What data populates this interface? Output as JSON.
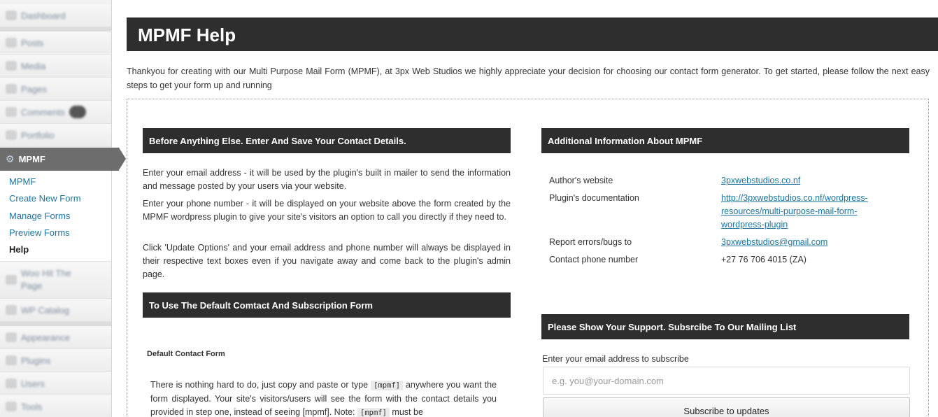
{
  "sidebar": {
    "items_top": [
      {
        "label": "Dashboard",
        "icon": "dashboard-icon"
      },
      {
        "label": "Posts",
        "icon": "posts-icon"
      },
      {
        "label": "Media",
        "icon": "media-icon"
      },
      {
        "label": "Pages",
        "icon": "pages-icon"
      },
      {
        "label": "Comments",
        "icon": "comments-icon"
      },
      {
        "label": "Portfolio",
        "icon": "portfolio-icon"
      }
    ],
    "current": {
      "label": "MPMF",
      "icon": "gear-icon"
    },
    "submenu": [
      {
        "label": "MPMF"
      },
      {
        "label": "Create New Form"
      },
      {
        "label": "Manage Forms"
      },
      {
        "label": "Preview Forms"
      },
      {
        "label": "Help",
        "active": true
      }
    ],
    "items_bottom": [
      {
        "label": "Woo Hit The Page",
        "icon": "plugin-icon"
      },
      {
        "label": "WP Catalog",
        "icon": "catalog-icon"
      },
      {
        "label": "Appearance",
        "icon": "appearance-icon"
      },
      {
        "label": "Plugins",
        "icon": "plugins-icon"
      },
      {
        "label": "Users",
        "icon": "users-icon"
      },
      {
        "label": "Tools",
        "icon": "tools-icon"
      }
    ]
  },
  "header": {
    "title": "MPMF Help"
  },
  "intro": "Thankyou for creating with our Multi Purpose Mail Form (MPMF), at 3px Web Studios we highly appreciate your decision for choosing our contact form generator. To get started, please follow the next easy steps to get your form up and running",
  "left": {
    "section1": {
      "title": "Before Anything Else. Enter And Save Your Contact Details.",
      "para1": "Enter your email address - it will be used by the plugin's built in mailer to send the information and message posted by your users via your website.",
      "para2": "Enter your phone number - it will be displayed on your website above the form created by the MPMF wordpress plugin to give your site's visitors an option to call you directly if they need to.",
      "para3": "Click 'Update Options' and your email address and phone number will always be displayed in their respective text boxes even if you navigate away and come back to the plugin's admin page."
    },
    "section2": {
      "title": "To Use The Default Comtact And Subscription Form",
      "form_title": "Default Contact Form",
      "text_a": "There is nothing hard to do, just copy and paste or type ",
      "code": "[mpmf]",
      "text_b": " anywhere you want the form displayed. Your site's visitors/users will see the form with the contact details you provided in step one, instead of seeing [mpmf]. Note: ",
      "text_c": " must be"
    }
  },
  "right": {
    "info": {
      "title": "Additional Information About MPMF",
      "rows": [
        {
          "label": "Author's website",
          "value": "3pxwebstudios.co.nf",
          "link": true
        },
        {
          "label": "Plugin's documentation",
          "value": "http://3pxwebstudios.co.nf/wordpress-resources/multi-purpose-mail-form-wordpress-plugin",
          "link": true
        },
        {
          "label": "Report errors/bugs to",
          "value": "3pxwebstudios@gmail.com",
          "link": true
        },
        {
          "label": "Contact phone number",
          "value": "+27 76 706 4015 (ZA)",
          "link": false
        }
      ]
    },
    "support": {
      "title": "Please Show Your Support. Subsrcibe To Our Mailing List",
      "label": "Enter your email address to subscribe",
      "placeholder": "e.g. you@your-domain.com",
      "button": "Subscribe  to updates"
    }
  },
  "colors": {
    "header_bg": "#2e2e2e",
    "link": "#21759b",
    "sidebar_bg": "#f1f1f1"
  }
}
